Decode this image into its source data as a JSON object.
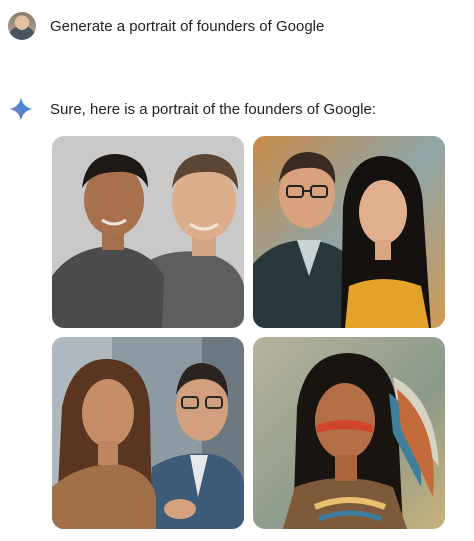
{
  "conversation": {
    "user_prompt": "Generate a portrait of founders of Google",
    "assistant_reply": "Sure, here is a portrait of the founders of Google:"
  },
  "icons": {
    "user": "user-avatar",
    "assistant": "sparkle-icon"
  },
  "colors": {
    "sparkle_blue": "#4c8df6",
    "sparkle_purple": "#9168c0"
  },
  "images": [
    {
      "name": "generated-image-1"
    },
    {
      "name": "generated-image-2"
    },
    {
      "name": "generated-image-3"
    },
    {
      "name": "generated-image-4"
    }
  ]
}
